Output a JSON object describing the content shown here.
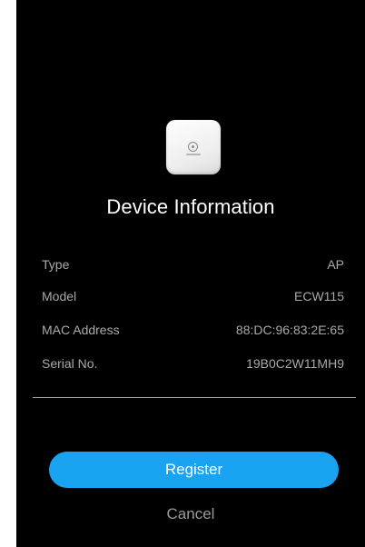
{
  "device": {
    "image_icon": "access-point-device-image",
    "title": "Device Information"
  },
  "info": [
    {
      "label": "Type",
      "value": "AP"
    },
    {
      "label": "Model",
      "value": "ECW115"
    },
    {
      "label": "MAC Address",
      "value": "88:DC:96:83:2E:65"
    },
    {
      "label": "Serial No.",
      "value": "19B0C2W11MH9"
    }
  ],
  "actions": {
    "register_label": "Register",
    "cancel_label": "Cancel"
  },
  "colors": {
    "background": "#000000",
    "accent": "#1aa3f0",
    "text_primary": "#ffffff",
    "text_secondary": "#a9a9a9"
  }
}
